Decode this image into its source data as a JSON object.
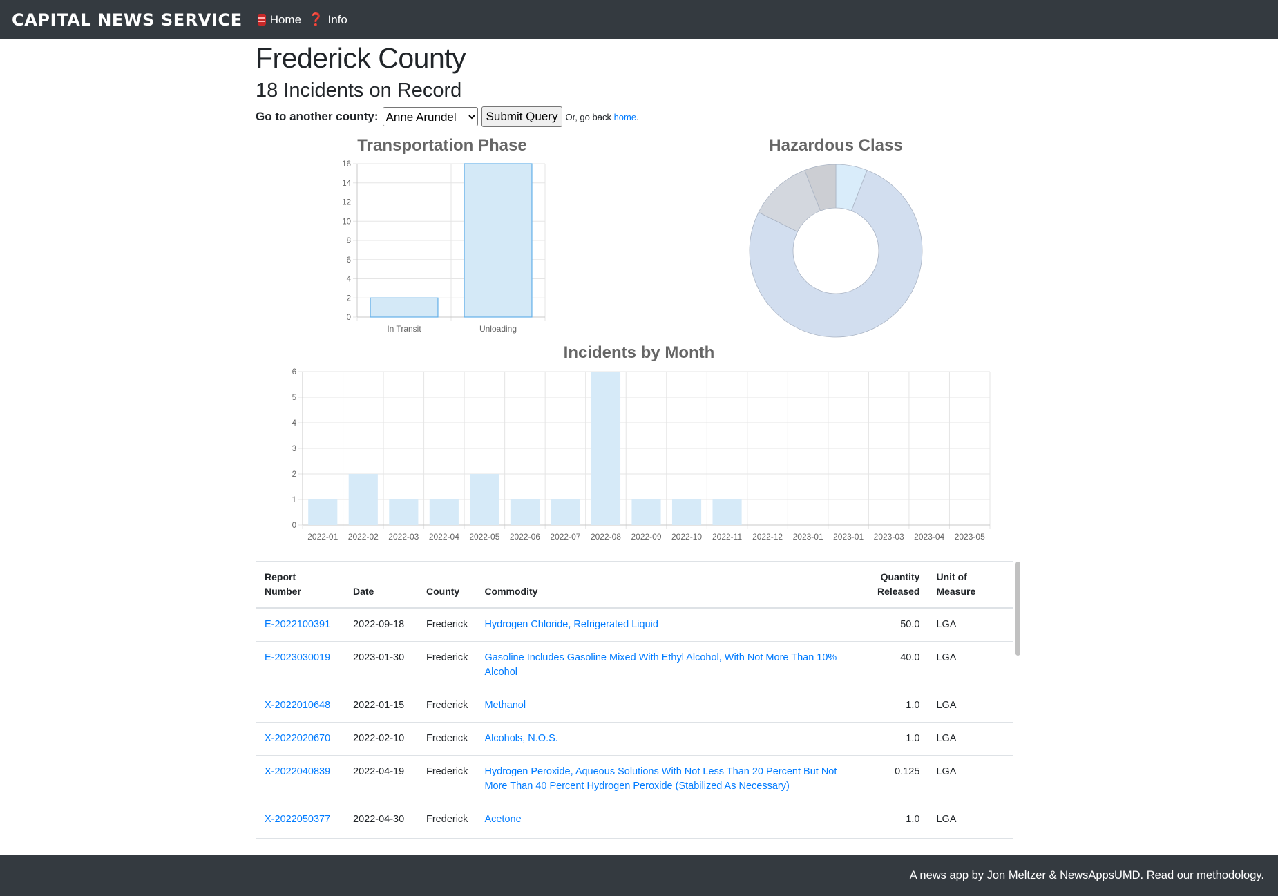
{
  "navbar": {
    "brand": "CAPITAL NEWS SERVICE",
    "home_label": "Home",
    "info_label": "Info",
    "home_icon": "database-icon",
    "info_icon": "question-icon"
  },
  "page": {
    "title": "Frederick County",
    "subtitle": "18 Incidents on Record"
  },
  "county_form": {
    "label": "Go to another county:",
    "selected_county": "Anne Arundel",
    "submit_label": "Submit Query",
    "go_back_prefix": "Or, go back ",
    "go_back_link": "home",
    "go_back_suffix": "."
  },
  "chart_data": [
    {
      "type": "bar",
      "title": "Transportation Phase",
      "categories": [
        "In Transit",
        "Unloading"
      ],
      "values": [
        2,
        16
      ],
      "ylim": [
        0,
        16
      ],
      "yticks": [
        0,
        2,
        4,
        6,
        8,
        10,
        12,
        14,
        16
      ],
      "grid": true,
      "color": "#d4e9f7",
      "stroke": "#64b0e8"
    },
    {
      "type": "pie",
      "title": "Hazardous Class",
      "values": [
        1,
        13,
        2,
        1
      ],
      "colors": [
        "#d9ecfa",
        "#d2deef",
        "#d3d7de",
        "#ccced3"
      ],
      "donut": true
    },
    {
      "type": "bar",
      "title": "Incidents by Month",
      "categories": [
        "2022-01",
        "2022-02",
        "2022-03",
        "2022-04",
        "2022-05",
        "2022-06",
        "2022-07",
        "2022-08",
        "2022-09",
        "2022-10",
        "2022-11",
        "2022-12",
        "2023-01",
        "2023-01",
        "2023-03",
        "2023-04",
        "2023-05"
      ],
      "values": [
        1,
        2,
        1,
        1,
        2,
        1,
        1,
        6,
        1,
        1,
        1,
        0,
        0,
        0,
        0,
        0,
        0
      ],
      "ylim": [
        0,
        6
      ],
      "yticks": [
        0,
        1,
        2,
        3,
        4,
        5,
        6
      ],
      "grid": true,
      "color": "#d6eaf8"
    }
  ],
  "table": {
    "headers": {
      "report_number": [
        "Report",
        "Number"
      ],
      "date": "Date",
      "county": "County",
      "commodity": "Commodity",
      "quantity": [
        "Quantity",
        "Released"
      ],
      "unit": [
        "Unit of",
        "Measure"
      ]
    },
    "rows": [
      {
        "report": "E-2022100391",
        "date": "2022-09-18",
        "county": "Frederick",
        "commodity": "Hydrogen Chloride, Refrigerated Liquid",
        "quantity": "50.0",
        "unit": "LGA"
      },
      {
        "report": "E-2023030019",
        "date": "2023-01-30",
        "county": "Frederick",
        "commodity": "Gasoline Includes Gasoline Mixed With Ethyl Alcohol, With Not More Than 10% Alcohol",
        "quantity": "40.0",
        "unit": "LGA"
      },
      {
        "report": "X-2022010648",
        "date": "2022-01-15",
        "county": "Frederick",
        "commodity": "Methanol",
        "quantity": "1.0",
        "unit": "LGA"
      },
      {
        "report": "X-2022020670",
        "date": "2022-02-10",
        "county": "Frederick",
        "commodity": "Alcohols, N.O.S.",
        "quantity": "1.0",
        "unit": "LGA"
      },
      {
        "report": "X-2022040839",
        "date": "2022-04-19",
        "county": "Frederick",
        "commodity": "Hydrogen Peroxide, Aqueous Solutions With Not Less Than 20 Percent But Not More Than 40 Percent Hydrogen Peroxide (Stabilized As Necessary)",
        "quantity": "0.125",
        "unit": "LGA"
      },
      {
        "report": "X-2022050377",
        "date": "2022-04-30",
        "county": "Frederick",
        "commodity": "Acetone",
        "quantity": "1.0",
        "unit": "LGA"
      }
    ]
  },
  "footer": {
    "text": "A news app by Jon Meltzer & NewsAppsUMD. Read our methodology."
  }
}
